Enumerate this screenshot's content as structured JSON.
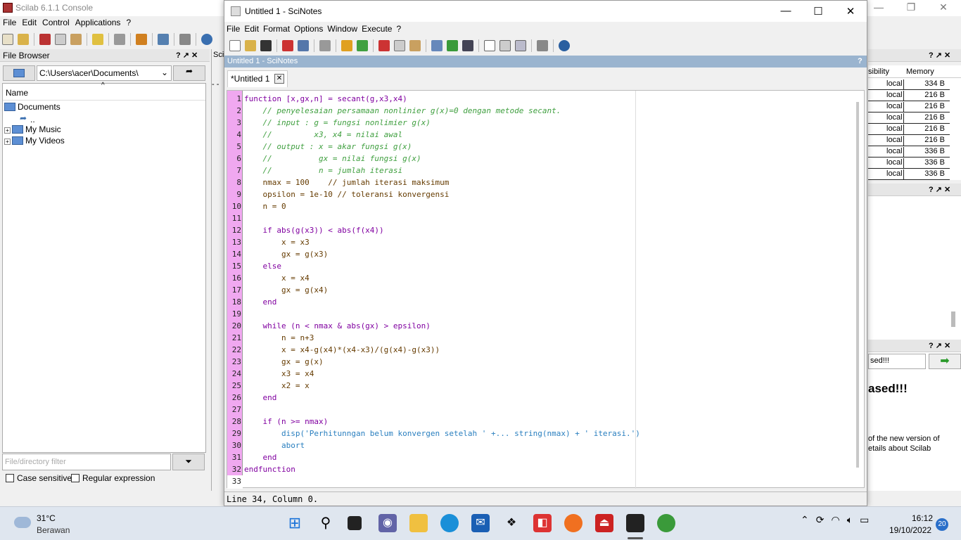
{
  "console": {
    "title": "Scilab 6.1.1 Console",
    "menu": [
      "File",
      "Edit",
      "Control",
      "Applications",
      "?"
    ],
    "strip_label": "Sci",
    "strip_prompt": "- -",
    "file_browser": {
      "header": "File Browser",
      "header_controls": "? ↗ ✕",
      "path": "C:\\Users\\acer\\Documents\\",
      "column_name": "Name",
      "items": {
        "documents": "Documents",
        "parent": "..",
        "my_music": "My Music",
        "my_videos": "My Videos"
      },
      "filter_placeholder": "File/directory filter",
      "case_sensitive": "Case sensitive",
      "regex": "Regular expression"
    },
    "var_browser": {
      "header_controls": "? ↗ ✕",
      "col_visibility": "sibility",
      "col_memory": "Memory",
      "rows": [
        {
          "vis": "local",
          "mem": "334 B"
        },
        {
          "vis": "local",
          "mem": "216 B"
        },
        {
          "vis": "local",
          "mem": "216 B"
        },
        {
          "vis": "local",
          "mem": "216 B"
        },
        {
          "vis": "local",
          "mem": "216 B"
        },
        {
          "vis": "local",
          "mem": "216 B"
        },
        {
          "vis": "local",
          "mem": "336 B"
        },
        {
          "vis": "local",
          "mem": "336 B"
        },
        {
          "vis": "local",
          "mem": "336 B"
        }
      ]
    },
    "history_controls": "? ↗ ✕",
    "news": {
      "header_controls": "? ↗ ✕",
      "search_value": "sed!!!",
      "title": "ased!!!",
      "body_line1": "of the new version of",
      "body_line2": "etails about Scilab"
    }
  },
  "scinotes": {
    "title": "Untitled 1 - SciNotes",
    "menu": [
      "File",
      "Edit",
      "Format",
      "Options",
      "Window",
      "Execute",
      "?"
    ],
    "doc_header": "Untitled 1 - SciNotes",
    "doc_header_help": "?",
    "tab_label": "*Untitled 1",
    "status": "Line 34, Column 0.",
    "code_lines": [
      "function [x,gx,n] = secant(g,x3,x4)",
      "    // penyelesaian persamaan nonlinier g(x)=0 dengan metode secant.",
      "    // input : g = fungsi nonlimier g(x)",
      "    //         x3, x4 = nilai awal",
      "    // output : x = akar fungsi g(x)",
      "    //          gx = nilai fungsi g(x)",
      "    //          n = jumlah iterasi",
      "    nmax = 100    // jumlah iterasi maksimum",
      "    opsilon = 1e-10 // toleransi konvergensi",
      "    n = 0",
      "",
      "    if abs(g(x3)) < abs(f(x4))",
      "        x = x3",
      "        gx = g(x3)",
      "    else",
      "        x = x4",
      "        gx = g(x4)",
      "    end",
      "",
      "    while (n < nmax & abs(gx) > epsilon)",
      "        n = n+3",
      "        x = x4-g(x4)*(x4-x3)/(g(x4)-g(x3))",
      "        gx = g(x)",
      "        x3 = x4",
      "        x2 = x",
      "    end",
      "",
      "    if (n >= nmax)",
      "        disp('Perhitunngan belum konvergen setelah ' +... string(nmax) + ' iterasi.')",
      "        abort",
      "    end",
      "endfunction",
      ""
    ]
  },
  "taskbar": {
    "temperature": "31°C",
    "weather": "Berawan",
    "time": "16:12",
    "date": "19/10/2022",
    "notifications": "20"
  },
  "colors": {
    "gutter": "#f0a8f0",
    "doc_header": "#9ab4cf",
    "keyword": "#8000a0",
    "comment": "#3f9f3f",
    "builtin": "#2a7fbf"
  }
}
